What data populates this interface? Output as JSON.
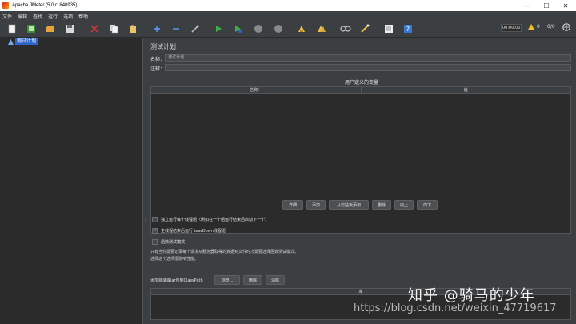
{
  "window": {
    "title": "Apache JMeter (5.0 r1840935)"
  },
  "menubar": {
    "items": [
      "文件",
      "编辑",
      "查找",
      "运行",
      "选项",
      "帮助"
    ]
  },
  "toolbar": {
    "timer": "00:00:00",
    "warnings": "0",
    "threads": "0/0"
  },
  "tree": {
    "root_label": "测试计划"
  },
  "main": {
    "title": "测试计划",
    "name_label": "名称：",
    "name_value": "测试计划",
    "comment_label": "注释：",
    "comment_value": "",
    "variables": {
      "title": "用户定义的变量",
      "col_name": "名称：",
      "col_value": "值"
    },
    "buttons": {
      "detail": "详细",
      "add": "添加",
      "add_from_clipboard": "从剪贴板添加",
      "delete": "删除",
      "up": "向上",
      "down": "向下"
    },
    "options": [
      {
        "label": "独立运行每个线程组（例如在一个组运行结束后启动下一个）",
        "checked": false
      },
      {
        "label": "主线程结束后运行 tearDown线程组",
        "checked": true
      },
      {
        "label": "函数测试模式",
        "checked": false
      }
    ],
    "note_line1": "只有当你需要记录每个请求从服务器取得的数据到文件时才需要选择函数测试模式。",
    "note_line2": "选择这个选项很影响性能。",
    "classpath": {
      "label": "添加目录或jar包到ClassPath",
      "browse": "浏览...",
      "delete": "删除",
      "clear": "清除",
      "col_header": "库"
    }
  },
  "watermark": {
    "zhihu": "知乎 @骑马的少年",
    "url": "https://blog.csdn.net/weixin_47719617"
  }
}
